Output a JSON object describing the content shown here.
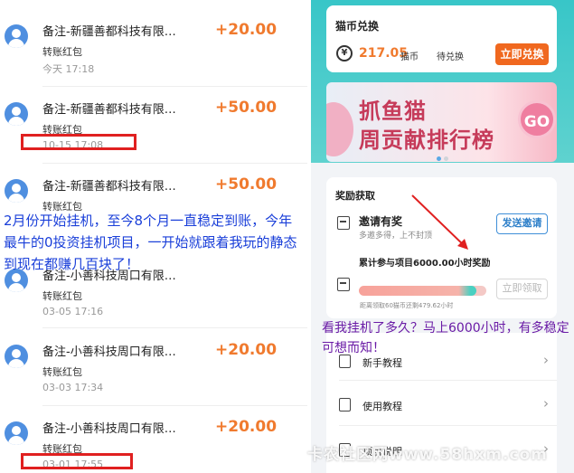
{
  "transactions": [
    {
      "title": "备注-新疆善都科技有限…",
      "sub": "转账红包",
      "date": "今天  17:18",
      "amount": "+20.00"
    },
    {
      "title": "备注-新疆善都科技有限…",
      "sub": "转账红包",
      "date": "10-15  17:08",
      "amount": "+50.00"
    },
    {
      "title": "备注-新疆善都科技有限…",
      "sub": "转账红包",
      "date": "",
      "amount": "+50.00"
    },
    {
      "title": "备注-小善科技周口有限…",
      "sub": "转账红包",
      "date": "03-05  17:16",
      "amount": ""
    },
    {
      "title": "备注-小善科技周口有限…",
      "sub": "转账红包",
      "date": "03-03  17:34",
      "amount": "+20.00"
    },
    {
      "title": "备注-小善科技周口有限…",
      "sub": "转账红包",
      "date": "03-01  17:55",
      "amount": "+20.00"
    }
  ],
  "annotation_left": "2月份开始挂机，至今8个月一直稳定到账，今年最牛的0投资挂机项目，一开始就跟着我玩的静态到现在都赚几百块了！",
  "coin_card": {
    "title": "猫币兑换",
    "coin_symbol": "¥",
    "value": "217.05",
    "unit": "猫币",
    "pending": "待兑换",
    "button": "立即兑换"
  },
  "banner": {
    "title": "抓鱼猫",
    "subtitle": "周贡献排行榜",
    "badge": "GO"
  },
  "rewards": {
    "title": "奖励获取",
    "invite_title": "邀请有奖",
    "invite_sub": "多邀多得，上不封顶",
    "invite_button": "发送邀请",
    "accumulate_title": "累计参与项目6000.00小时奖励",
    "accumulate_note": "距离领取60猫币还剩479.62小时",
    "progress": 0.92,
    "claim_button": "立即领取"
  },
  "annotation_right": "看我挂机了多久？马上6000小时，有多稳定可想而知！",
  "menu": [
    {
      "label": "新手教程"
    },
    {
      "label": "使用教程"
    },
    {
      "label": "项目说明"
    }
  ],
  "watermark": "卡农社区网www.58hxm.com"
}
